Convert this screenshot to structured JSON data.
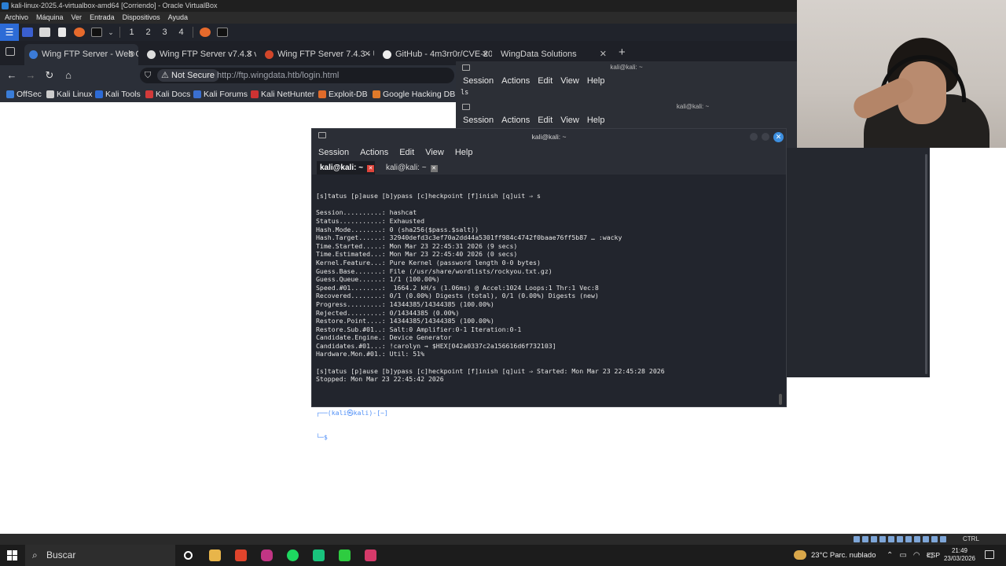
{
  "vbox": {
    "title": "kali-linux-2025.4-virtualbox-amd64 [Corriendo] - Oracle VirtualBox",
    "menu": [
      "Archivo",
      "Máquina",
      "Ver",
      "Entrada",
      "Dispositivos",
      "Ayuda"
    ],
    "status_hostkey": "CTRL DERECHA"
  },
  "kali_panel": {
    "workspaces": [
      "1",
      "2",
      "3",
      "4"
    ]
  },
  "browser": {
    "tabs": [
      {
        "label": "Wing FTP Server - Web Cl",
        "active": true
      },
      {
        "label": "Wing FTP Server v7.4.3 vu",
        "active": false
      },
      {
        "label": "Wing FTP Server 7.4.3 - U",
        "active": false
      },
      {
        "label": "GitHub - 4m3rr0r/CVE-20",
        "active": false
      },
      {
        "label": "WingData Solutions",
        "active": false
      }
    ],
    "new_tab": "+",
    "not_secure": "Not Secure",
    "url": "http://ftp.wingdata.htb/login.html",
    "bookmarks": [
      "OffSec",
      "Kali Linux",
      "Kali Tools",
      "Kali Docs",
      "Kali Forums",
      "Kali NetHunter",
      "Exploit-DB",
      "Google Hacking DB"
    ]
  },
  "bg_term1": {
    "title": "kali@kali: ~",
    "menu": [
      "Session",
      "Actions",
      "Edit",
      "View",
      "Help"
    ],
    "content": "ls"
  },
  "bg_term2": {
    "title": "kali@kali: ~",
    "menu": [
      "Session",
      "Actions",
      "Edit",
      "View",
      "Help"
    ]
  },
  "main_term": {
    "title": "kali@kali: ~",
    "menu": [
      "Session",
      "Actions",
      "Edit",
      "View",
      "Help"
    ],
    "tabs": [
      {
        "label": "kali@kali: ~",
        "active": true
      },
      {
        "label": "kali@kali: ~",
        "active": false
      }
    ],
    "lines": [
      "[s]tatus [p]ause [b]ypass [c]heckpoint [f]inish [q]uit ⇒ s",
      "",
      "Session..........: hashcat",
      "Status...........: Exhausted",
      "Hash.Mode........: 0 (sha256($pass.$salt))",
      "Hash.Target......: 32940defd3c3ef70a2dd44a5301ff984c4742f0baae76ff5b87 … :wacky",
      "Time.Started.....: Mon Mar 23 22:45:31 2026 (9 secs)",
      "Time.Estimated...: Mon Mar 23 22:45:40 2026 (0 secs)",
      "Kernel.Feature...: Pure Kernel (password length 0-0 bytes)",
      "Guess.Base.......: File (/usr/share/wordlists/rockyou.txt.gz)",
      "Guess.Queue......: 1/1 (100.00%)",
      "Speed.#01........:  1664.2 kH/s (1.06ms) @ Accel:1024 Loops:1 Thr:1 Vec:8",
      "Recovered........: 0/1 (0.00%) Digests (total), 0/1 (0.00%) Digests (new)",
      "Progress.........: 14344385/14344385 (100.00%)",
      "Rejected.........: 0/14344385 (0.00%)",
      "Restore.Point....: 14344385/14344385 (100.00%)",
      "Restore.Sub.#01..: Salt:0 Amplifier:0-1 Iteration:0-1",
      "Candidate.Engine.: Device Generator",
      "Candidates.#01...: !carolyn → $HEX[042a0337c2a156616d6f732103]",
      "Hardware.Mon.#01.: Util: 51%",
      "",
      "[s]tatus [p]ause [b]ypass [c]heckpoint [f]inish [q]uit ⇒ Started: Mon Mar 23 22:45:28 2026",
      "Stopped: Mon Mar 23 22:45:42 2026",
      ""
    ],
    "prompt_line1": "┌──(kali㉿kali)-[~]",
    "prompt_line2": "└─$ "
  },
  "taskbar": {
    "search_placeholder": "Buscar",
    "weather": "23°C  Parc. nublado",
    "language": "ESP",
    "time": "21:49",
    "date": "23/03/2026"
  },
  "colors": {
    "kali_blue": "#2d6bd6",
    "terminal_bg": "#22252d",
    "prompt_blue": "#4f8ff7",
    "close_red": "#e0443a"
  }
}
